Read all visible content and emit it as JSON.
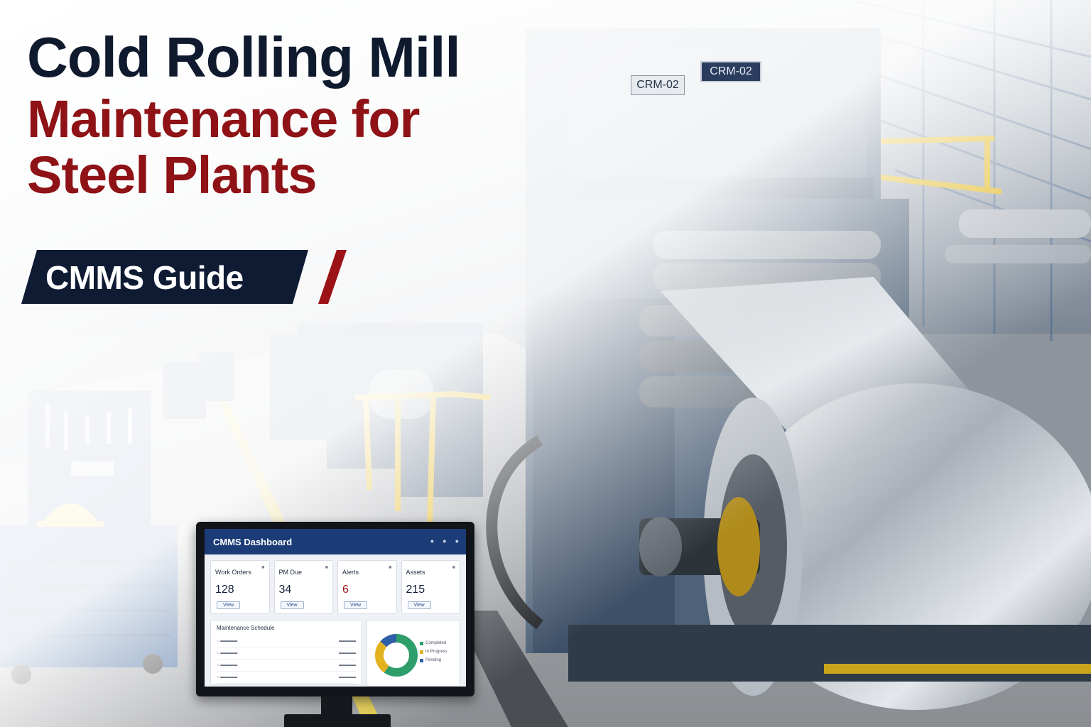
{
  "headline": {
    "line1": "Cold Rolling Mill",
    "line2": "Maintenance for",
    "line3": "Steel Plants",
    "badge": "CMMS Guide"
  },
  "machine_plates": {
    "plate1": "CRM-02",
    "plate2": "CRM-02"
  },
  "dashboard": {
    "title": "CMMS Dashboard",
    "cards": [
      {
        "label": "Work Orders",
        "value": "128",
        "button": "View"
      },
      {
        "label": "PM Due",
        "value": "34",
        "button": "View"
      },
      {
        "label": "Alerts",
        "value": "6",
        "button": "View"
      },
      {
        "label": "Assets",
        "value": "215",
        "button": "View"
      }
    ],
    "schedule_title": "Maintenance Schedule",
    "legend": [
      "Completed",
      "In Progress",
      "Pending"
    ],
    "colors": {
      "header": "#1c3c78",
      "completed": "#2e9e6b",
      "in_progress": "#e3b21f",
      "pending": "#2f5fa8"
    }
  },
  "colors": {
    "title_dark": "#0f1a2e",
    "title_red": "#8e1216",
    "badge_bg": "#0e1b33",
    "badge_slash": "#9b1217"
  }
}
